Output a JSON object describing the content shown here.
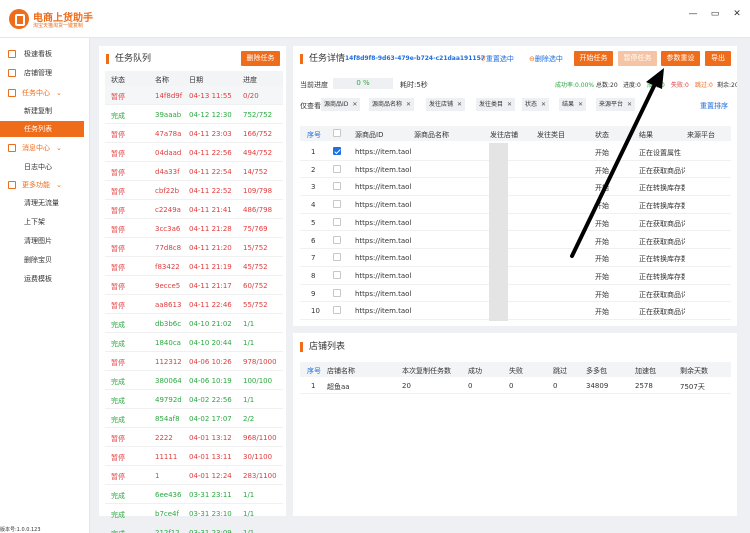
{
  "app": {
    "title": "电商上货助手",
    "subtitle": "淘宝天猫淘货一键复制",
    "version": "版本号:1.0.0.123",
    "window_buttons": [
      "—",
      "▭",
      "✕"
    ]
  },
  "sidebar": {
    "items": [
      {
        "label": "极速看板",
        "type": "top",
        "icon": "dashboard-icon"
      },
      {
        "label": "店铺管理",
        "type": "top",
        "icon": "store-icon"
      },
      {
        "label": "任务中心",
        "type": "group",
        "icon": "task-icon"
      },
      {
        "label": "新建复制",
        "type": "sub"
      },
      {
        "label": "任务列表",
        "type": "sub",
        "active": true
      },
      {
        "label": "消息中心",
        "type": "group",
        "icon": "message-icon"
      },
      {
        "label": "日志中心",
        "type": "sub"
      },
      {
        "label": "更多功能",
        "type": "group",
        "icon": "more-icon"
      },
      {
        "label": "清理无流量",
        "type": "sub"
      },
      {
        "label": "上下架",
        "type": "sub"
      },
      {
        "label": "清理图片",
        "type": "sub"
      },
      {
        "label": "删除宝贝",
        "type": "sub"
      },
      {
        "label": "运费模板",
        "type": "sub"
      }
    ]
  },
  "queue": {
    "title": "任务队列",
    "delete_label": "删除任务",
    "columns": [
      "状态",
      "名称",
      "日期",
      "进度"
    ],
    "rows": [
      [
        "暂停",
        "14f8d9f",
        "04-13 11:55",
        "0/20"
      ],
      [
        "完成",
        "39aaab",
        "04-12 12:30",
        "752/752"
      ],
      [
        "暂停",
        "47a78a",
        "04-11 23:03",
        "166/752"
      ],
      [
        "暂停",
        "04daad",
        "04-11 22:56",
        "494/752"
      ],
      [
        "暂停",
        "d4a33f",
        "04-11 22:54",
        "14/752"
      ],
      [
        "暂停",
        "cbf22b",
        "04-11 22:52",
        "109/798"
      ],
      [
        "暂停",
        "c2249a",
        "04-11 21:41",
        "486/798"
      ],
      [
        "暂停",
        "3cc3a6",
        "04-11 21:28",
        "75/769"
      ],
      [
        "暂停",
        "77d8c8",
        "04-11 21:20",
        "15/752"
      ],
      [
        "暂停",
        "f83422",
        "04-11 21:19",
        "45/752"
      ],
      [
        "暂停",
        "9ecce5",
        "04-11 21:17",
        "60/752"
      ],
      [
        "暂停",
        "aa8613",
        "04-11 22:46",
        "55/752"
      ],
      [
        "完成",
        "db3b6c",
        "04-10 21:02",
        "1/1"
      ],
      [
        "完成",
        "1840ca",
        "04-10 20:44",
        "1/1"
      ],
      [
        "暂停",
        "112312",
        "04-06 10:26",
        "978/1000"
      ],
      [
        "完成",
        "380064",
        "04-06 10:19",
        "100/100"
      ],
      [
        "完成",
        "49792d",
        "04-02 22:56",
        "1/1"
      ],
      [
        "完成",
        "854af8",
        "04-02 17:07",
        "2/2"
      ],
      [
        "暂停",
        "2222",
        "04-01 13:12",
        "968/1100"
      ],
      [
        "暂停",
        "11111",
        "04-01 13:11",
        "30/1100"
      ],
      [
        "暂停",
        "1",
        "04-01 12:24",
        "283/1100"
      ],
      [
        "完成",
        "6ee436",
        "03-31 23:11",
        "1/1"
      ],
      [
        "完成",
        "b7ce4f",
        "03-31 23:10",
        "1/1"
      ],
      [
        "完成",
        "212f12",
        "03-31 23:09",
        "1/1"
      ]
    ]
  },
  "detail": {
    "title": "任务详情",
    "task_id": "14f8d9f8-9d63-479e-b724-c21daa191157",
    "reselect": "重置选中",
    "delete_selected": "删除选中",
    "buttons": {
      "start": "开始任务",
      "pause": "暂停任务",
      "params": "参数重设",
      "export": "导出"
    },
    "progress_label": "当前进度",
    "progress_value": "0 %",
    "elapsed": "耗时:5秒",
    "stats": {
      "success_rate": "成功率:0.00%",
      "total": "总数:20",
      "progress": "进度:0",
      "success": "成功:0",
      "fail": "失败:0",
      "skip": "跳过:0",
      "remaining": "剩余:20"
    },
    "filter_label": "仅查看",
    "filters": [
      "源商品ID",
      "源商品名称",
      "发往店铺",
      "发往类目",
      "状态",
      "结果",
      "来源平台"
    ],
    "reset_sort": "重置排序",
    "columns": [
      "序号",
      "",
      "源商品ID",
      "源商品名称",
      "发往店铺",
      "发往类目",
      "状态",
      "结果",
      "来源平台"
    ],
    "rows": [
      {
        "n": "1",
        "checked": true,
        "url": "https://item.taol",
        "status": "开始",
        "result": "正在设置属性"
      },
      {
        "n": "2",
        "checked": false,
        "url": "https://item.taol",
        "status": "开始",
        "result": "正在获取商品详情"
      },
      {
        "n": "3",
        "checked": false,
        "url": "https://item.taol",
        "status": "开始",
        "result": "正在转换库存数据"
      },
      {
        "n": "4",
        "checked": false,
        "url": "https://item.taol",
        "status": "开始",
        "result": "正在转换库存数据"
      },
      {
        "n": "5",
        "checked": false,
        "url": "https://item.taol",
        "status": "开始",
        "result": "正在获取商品详情"
      },
      {
        "n": "6",
        "checked": false,
        "url": "https://item.taol",
        "status": "开始",
        "result": "正在获取商品详情"
      },
      {
        "n": "7",
        "checked": false,
        "url": "https://item.taol",
        "status": "开始",
        "result": "正在转换库存数据"
      },
      {
        "n": "8",
        "checked": false,
        "url": "https://item.taol",
        "status": "开始",
        "result": "正在转换库存数据"
      },
      {
        "n": "9",
        "checked": false,
        "url": "https://item.taol",
        "status": "开始",
        "result": "正在获取商品详情"
      },
      {
        "n": "10",
        "checked": false,
        "url": "https://item.taol",
        "status": "开始",
        "result": "正在获取商品详情"
      }
    ]
  },
  "shops": {
    "title": "店铺列表",
    "columns": [
      "序号",
      "店铺名称",
      "本次复制任务数",
      "成功",
      "失败",
      "跳过",
      "多多包",
      "加速包",
      "剩余天数"
    ],
    "rows": [
      [
        "1",
        "超鱼aa",
        "20",
        "0",
        "0",
        "0",
        "34809",
        "2578",
        "7507天"
      ]
    ]
  },
  "colors": {
    "accent": "#ef6c1a",
    "pause": "#e03c3c",
    "done": "#2ba840",
    "checked": "#1e6fe0"
  }
}
